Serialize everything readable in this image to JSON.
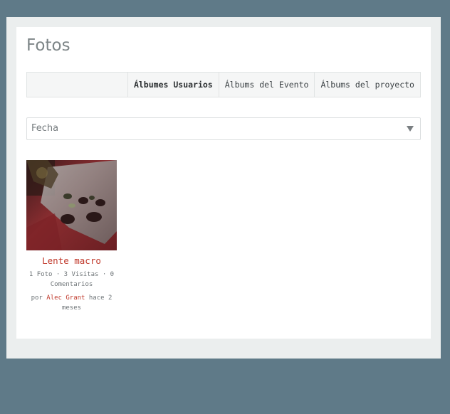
{
  "page": {
    "title": "Fotos"
  },
  "tabs": [
    {
      "label": "Álbumes Usuarios",
      "active": true
    },
    {
      "label": "Álbums del Evento",
      "active": false
    },
    {
      "label": "Álbums del proyecto",
      "active": false
    }
  ],
  "sort_select": {
    "value": "Fecha"
  },
  "albums": [
    {
      "title": "Lente macro",
      "stats": "1 Foto · 3 Visitas · 0 Comentarios",
      "author_prefix": "por",
      "author": "Alec Grant",
      "time": "hace 2 meses"
    }
  ],
  "colors": {
    "link": "#c0392b",
    "background": "#5f7a88"
  }
}
